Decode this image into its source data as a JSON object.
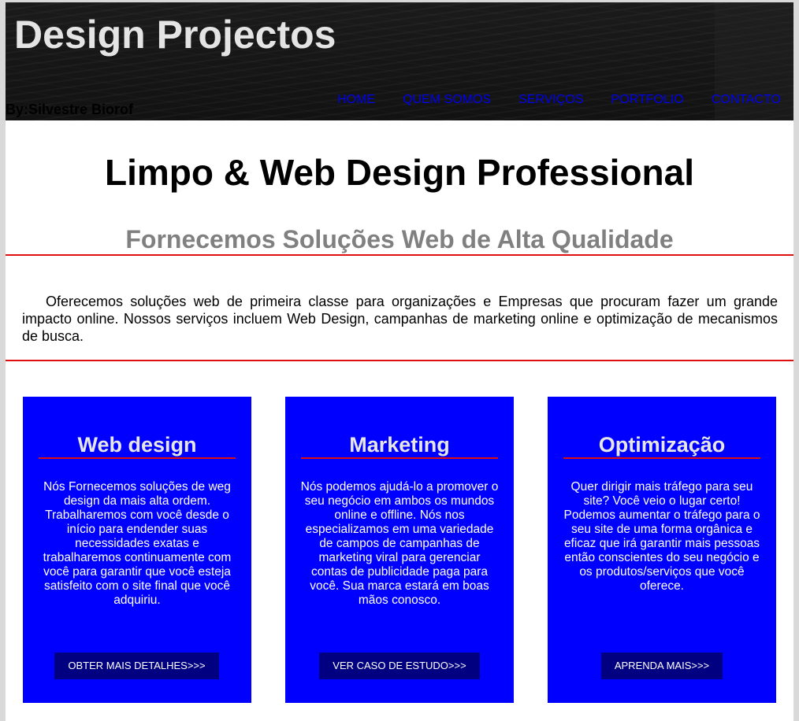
{
  "header": {
    "site_title": "Design Projectos",
    "byline": "By:Silvestre Biorof",
    "nav": [
      {
        "label": "HOME"
      },
      {
        "label": "QUEM SOMOS"
      },
      {
        "label": "SERVIÇOS"
      },
      {
        "label": "PORTFOLIO"
      },
      {
        "label": "CONTACTO"
      }
    ]
  },
  "hero": {
    "title": "Limpo & Web Design Professional",
    "subtitle": "Fornecemos Soluções Web de Alta Qualidade",
    "intro": "Oferecemos soluções web de primeira classe para organizações e Empresas que procuram fazer um grande impacto online. Nossos serviços incluem Web Design, campanhas de marketing online e optimização de mecanismos de busca."
  },
  "cards": [
    {
      "title": "Web design",
      "text": "Nós Fornecemos soluções de weg design da mais alta ordem. Trabalharemos com você desde o início para endender suas necessidades exatas e trabalharemos continuamente com você para garantir que você esteja satisfeito com o site final que você adquiriu.",
      "button": "OBTER MAIS DETALHES>>>"
    },
    {
      "title": "Marketing",
      "text": "Nós podemos ajudá-lo a promover o seu negócio em ambos os mundos online e offline. Nós nos especializamos em uma variedade de campos de campanhas de marketing viral para gerenciar contas de publicidade paga para você. Sua marca estará em boas mãos conosco.",
      "button": "VER CASO DE ESTUDO>>>"
    },
    {
      "title": "Optimização",
      "text": "Quer dirigir mais tráfego para seu site? Você veio o lugar certo! Podemos aumentar o tráfego para o seu site de uma forma orgânica e eficaz que irá garantir mais pessoas então conscientes do seu negócio e os produtos/serviços que você oferece.",
      "button": "APRENDA MAIS>>>"
    }
  ],
  "colors": {
    "card_background": "#0000ff",
    "button_background": "#000080",
    "accent_rule": "#e01010",
    "nav_link": "#0000ee",
    "subtitle": "#808080"
  }
}
